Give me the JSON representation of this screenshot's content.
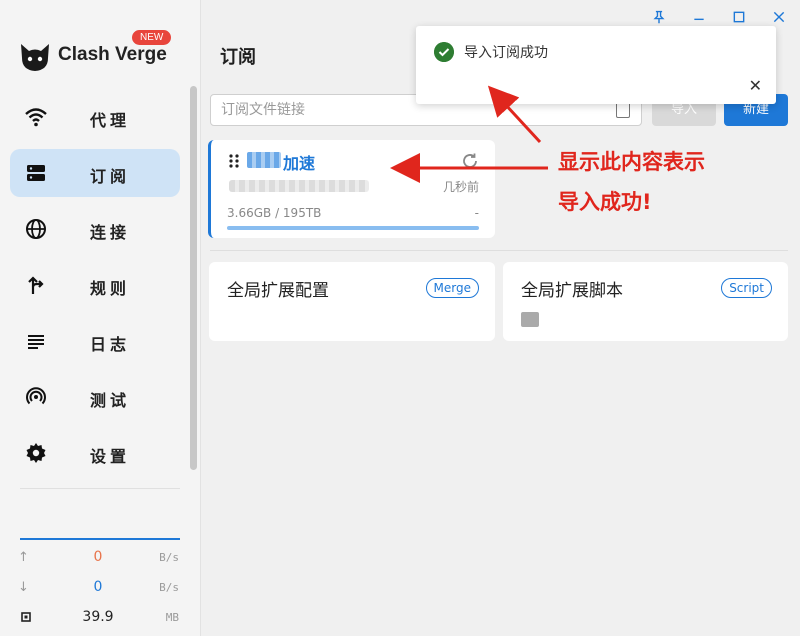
{
  "app": {
    "name": "Clash Verge",
    "badge": "NEW"
  },
  "nav": [
    {
      "label": "代理",
      "icon": "wifi-icon",
      "active": false
    },
    {
      "label": "订阅",
      "icon": "server-icon",
      "active": true
    },
    {
      "label": "连接",
      "icon": "globe-icon",
      "active": false
    },
    {
      "label": "规则",
      "icon": "fork-icon",
      "active": false
    },
    {
      "label": "日志",
      "icon": "list-icon",
      "active": false
    },
    {
      "label": "测试",
      "icon": "wireless-icon",
      "active": false
    },
    {
      "label": "设置",
      "icon": "gear-icon",
      "active": false
    }
  ],
  "traffic": {
    "upload": {
      "value": "0",
      "unit": "B/s",
      "color": "#e8734a"
    },
    "download": {
      "value": "0",
      "unit": "B/s",
      "color": "#1e78d7"
    },
    "memory": {
      "value": "39.9",
      "unit": "MB"
    }
  },
  "page": {
    "title": "订阅"
  },
  "import_bar": {
    "placeholder": "订阅文件链接",
    "import_label": "导入",
    "new_label": "新建"
  },
  "subscription": {
    "name": "加速",
    "updated": "几秒前",
    "usage": "3.66GB / 195TB",
    "expire": "-",
    "usage_fraction": 1.0
  },
  "extensions": [
    {
      "title": "全局扩展配置",
      "tag": "Merge"
    },
    {
      "title": "全局扩展脚本",
      "tag": "Script"
    }
  ],
  "toast": {
    "message": "导入订阅成功"
  },
  "annotation": {
    "line1": "显示此内容表示",
    "line2": "导入成功!"
  },
  "colors": {
    "accent": "#1e78d7",
    "annotation": "#e0261d",
    "success": "#2e7d32"
  }
}
